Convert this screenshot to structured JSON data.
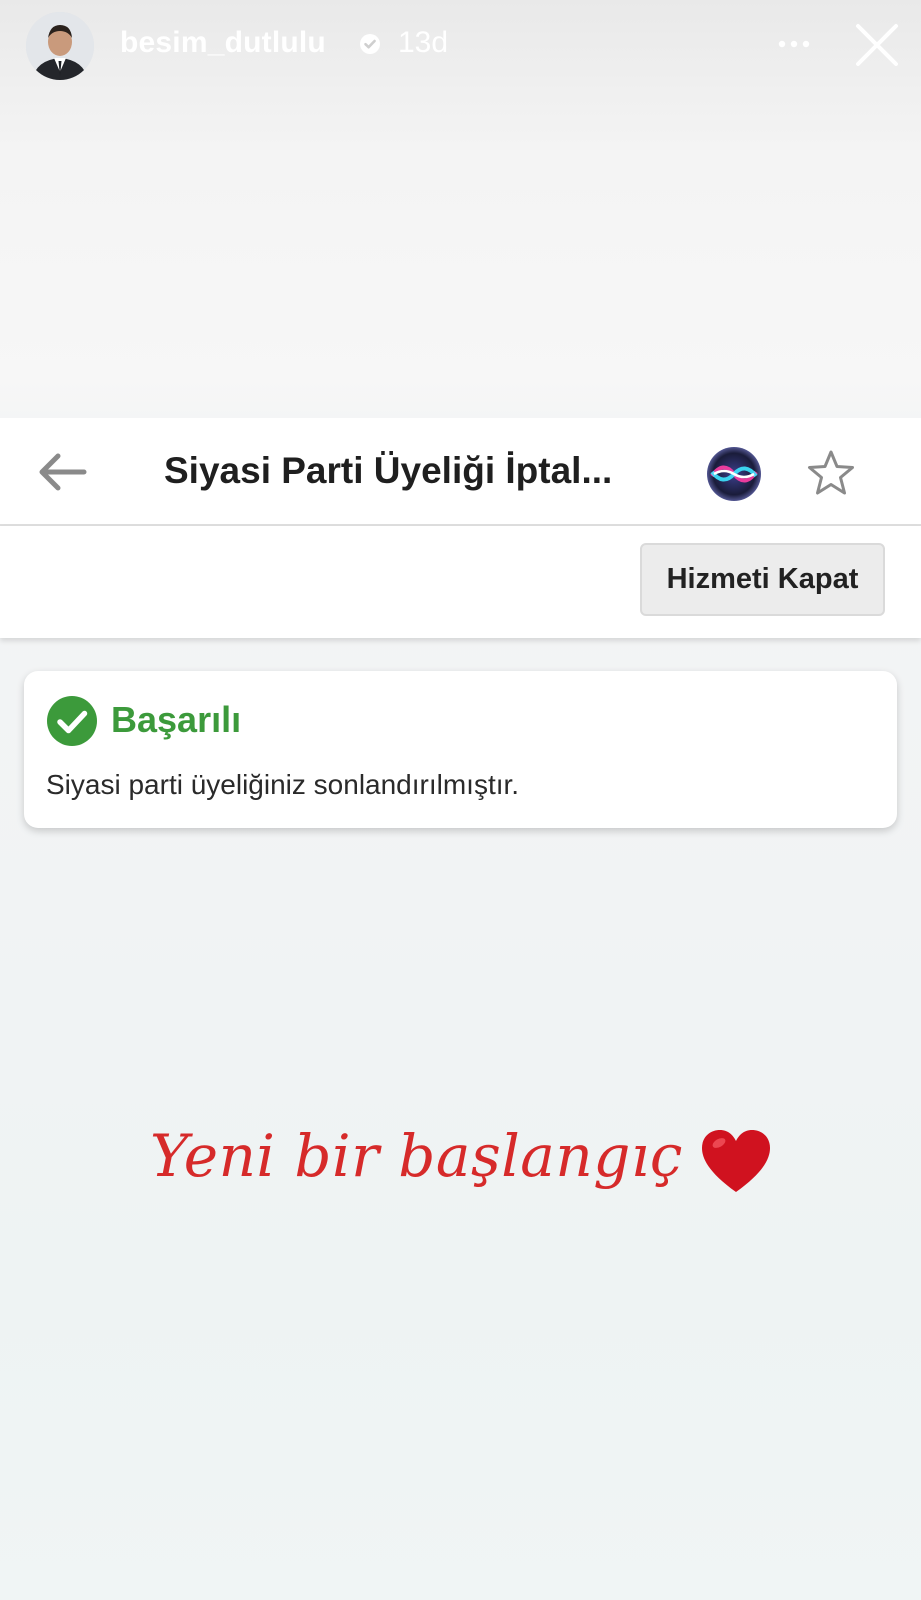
{
  "story": {
    "username": "besim_dutlulu",
    "age": "13d",
    "icons": {
      "avatar": "profile-photo",
      "verified": "verified-badge-icon",
      "more": "more-dots-icon",
      "close": "close-icon"
    }
  },
  "app": {
    "title": "Siyasi Parti Üyeliği İptal...",
    "close_service_label": "Hizmeti Kapat",
    "icons": {
      "back": "back-arrow-icon",
      "siri": "siri-icon",
      "favorite": "star-icon"
    },
    "alert": {
      "title": "Başarılı",
      "message": "Siyasi parti üyeliğiniz sonlandırılmıştır.",
      "icon": "check-circle-icon",
      "color": "#3c9a3b"
    }
  },
  "caption": {
    "text": "Yeni bir başlangıç",
    "emoji": "heart-icon",
    "color": "#d62a2a"
  }
}
